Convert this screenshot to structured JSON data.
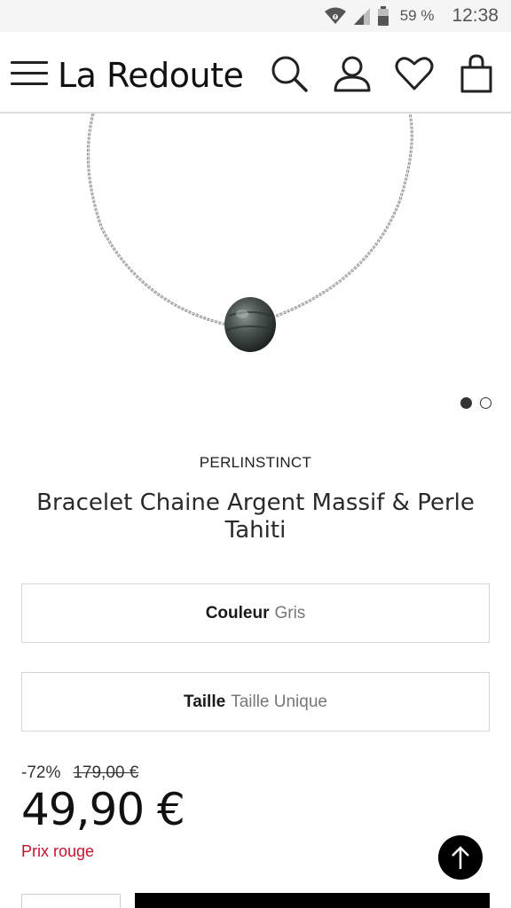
{
  "status_bar": {
    "battery": "59 %",
    "time": "12:38"
  },
  "header": {
    "brand": "La Redoute",
    "icons": [
      "menu-icon",
      "search-icon",
      "account-icon",
      "wishlist-heart-icon",
      "shopping-bag-icon"
    ]
  },
  "gallery": {
    "image": "bracelet chain with pearl",
    "page_count": 2,
    "active_index": 0
  },
  "product": {
    "brand": "PERLINSTINCT",
    "title": "Bracelet Chaine Argent Massif & Perle Tahiti"
  },
  "options": {
    "color_label": "Couleur",
    "color_value": "Gris",
    "size_label": "Taille",
    "size_value": "Taille Unique"
  },
  "pricing": {
    "discount": "-72%",
    "old_price": "179,00 €",
    "price": "49,90 €",
    "label": "Prix rouge",
    "label_color": "#c8102e"
  }
}
